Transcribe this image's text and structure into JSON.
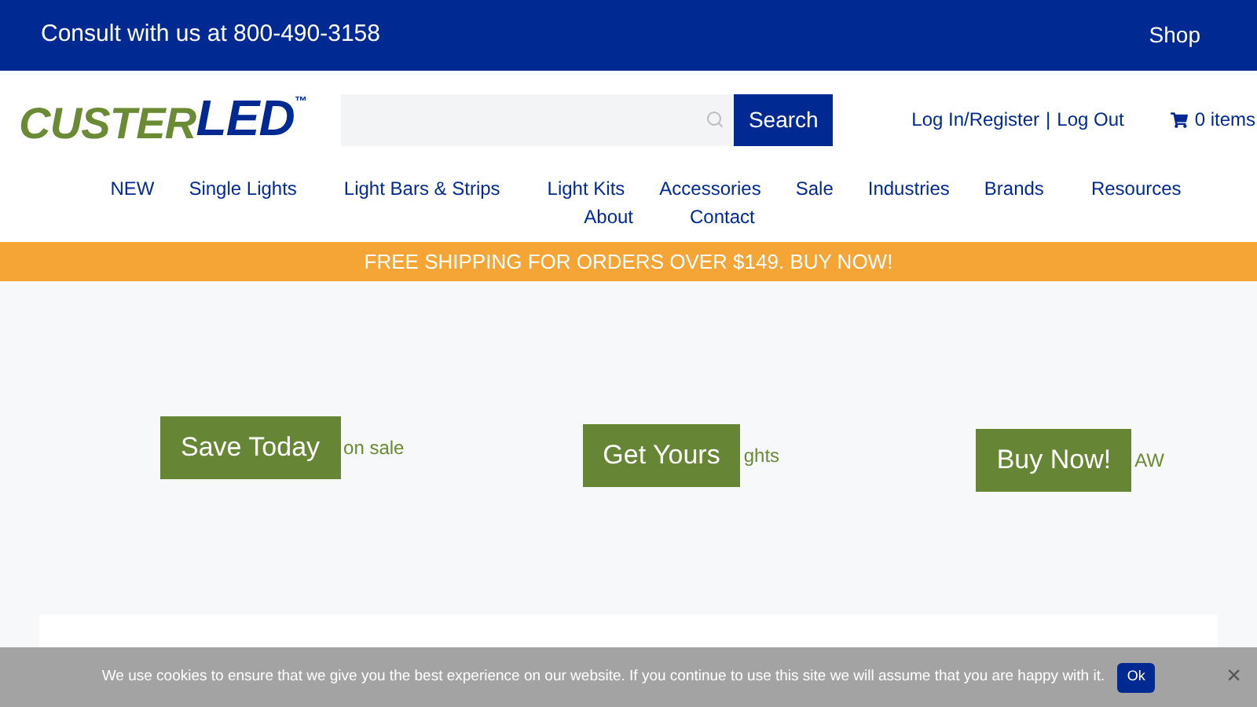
{
  "top_bar": {
    "phone_text": "Consult with us at 800-490-3158",
    "shop_link": "Shop"
  },
  "logo": {
    "part_1": "CUSTER",
    "part_2": "LED",
    "mark": "™"
  },
  "search": {
    "button": "Search"
  },
  "account": {
    "login": "Log In/Register",
    "separator": "|",
    "logout": "Log Out",
    "cart": "0 items"
  },
  "nav": [
    "NEW",
    "Single Lights",
    "Light Bars & Strips",
    "Light Kits",
    "Accessories",
    "Sale",
    "Industries",
    "Brands",
    "Resources",
    "About",
    "Contact"
  ],
  "promo_banner": "FREE SHIPPING FOR ORDERS OVER $149. BUY NOW!",
  "hero_slides": [
    {
      "button": "Save Today",
      "caption": "on sale"
    },
    {
      "button": "Get Yours",
      "caption": "ghts"
    },
    {
      "button": "Buy Now!",
      "caption": "AW"
    }
  ],
  "cookie_bar": {
    "message": "We use cookies to ensure that we give you the best experience on our website. If you continue to use this site we will assume that you are happy with it.",
    "button": "Ok",
    "close": "×"
  }
}
